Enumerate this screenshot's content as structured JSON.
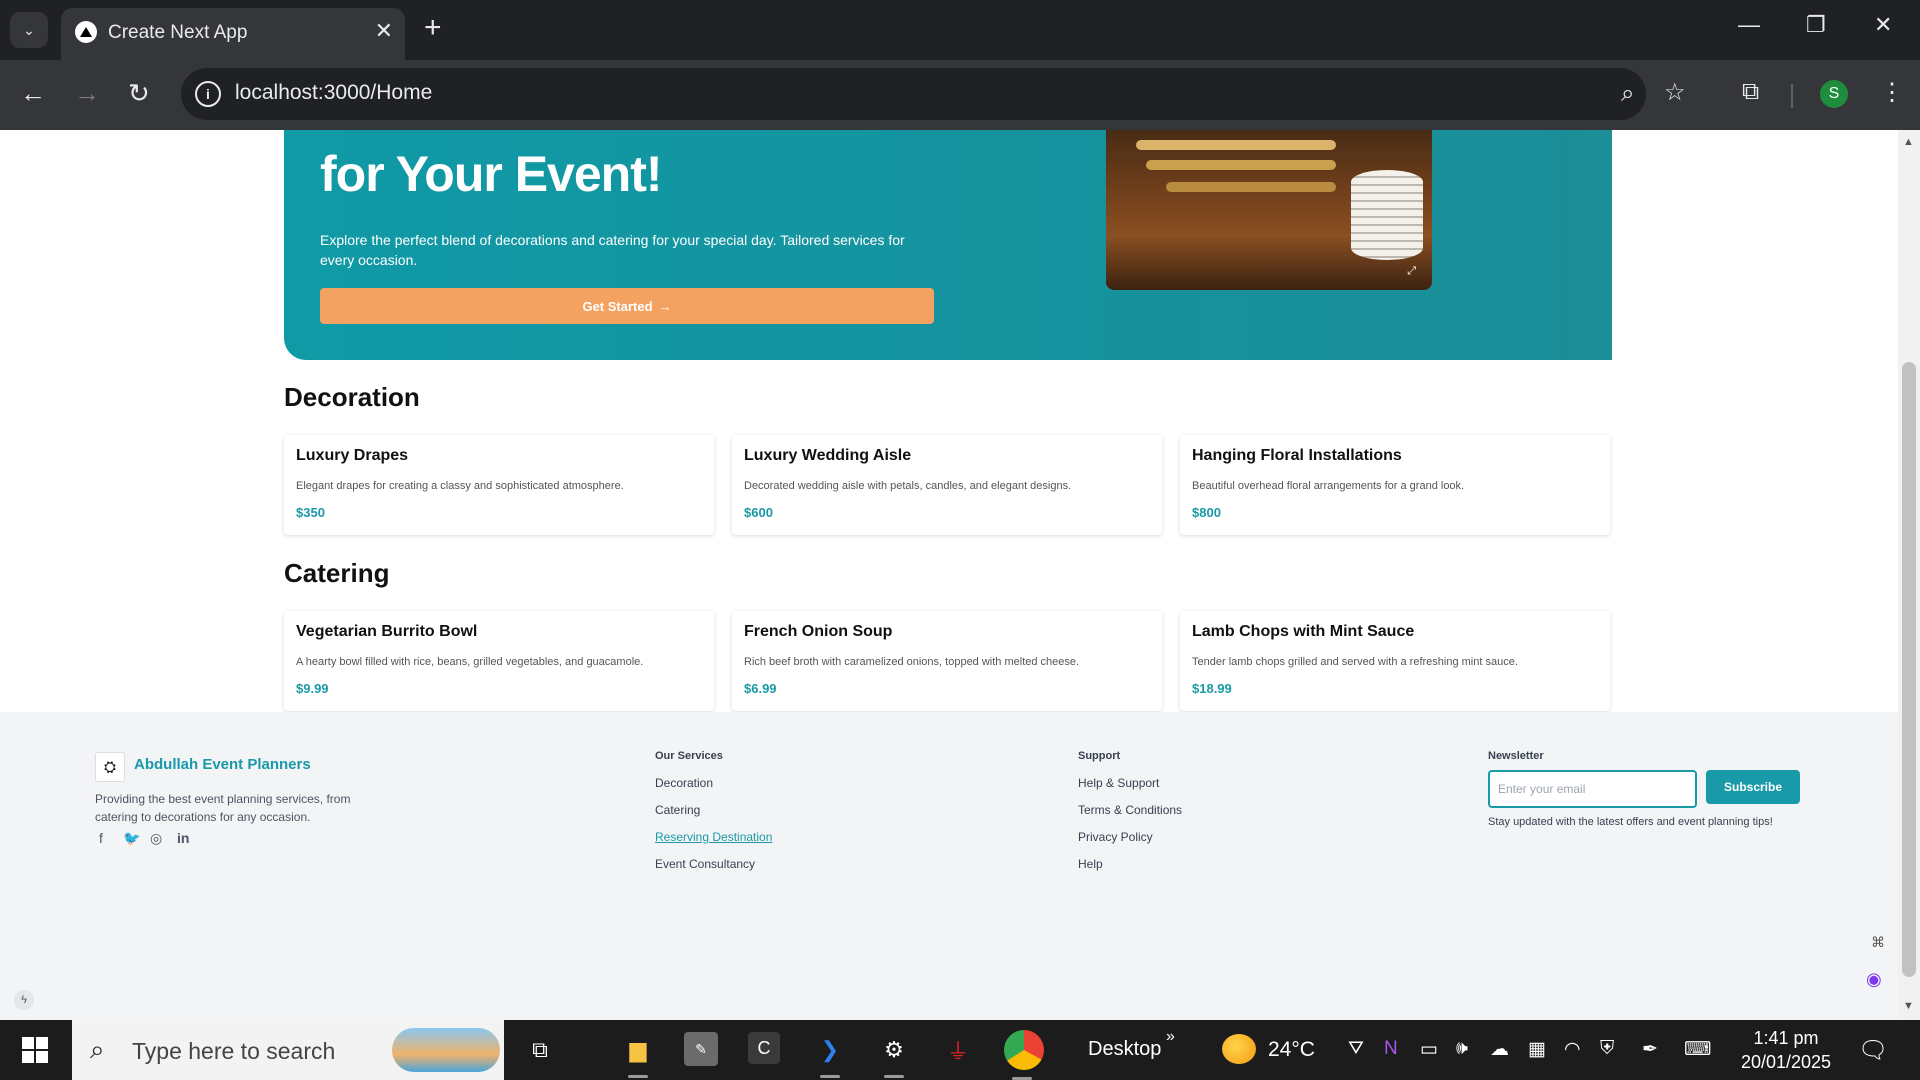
{
  "browser": {
    "tab_title": "Create Next App",
    "url": "localhost:3000/Home",
    "profile_initial": "S",
    "icons": [
      "tab-dropdown-icon",
      "close-icon",
      "plus-icon",
      "minimize-icon",
      "restore-icon",
      "back-icon",
      "forward-icon",
      "reload-icon",
      "info-icon",
      "zoom-icon",
      "star-icon",
      "extensions-icon",
      "kebab-menu-icon"
    ]
  },
  "hero": {
    "title": "for Your Event!",
    "description": "Explore the perfect blend of decorations and catering for your special day. Tailored services for every occasion.",
    "cta_label": "Get Started",
    "cta_icon": "→"
  },
  "decoration": {
    "heading": "Decoration",
    "items": [
      {
        "name": "Luxury Drapes",
        "desc": "Elegant drapes for creating a classy and sophisticated atmosphere.",
        "price": "$350"
      },
      {
        "name": "Luxury Wedding Aisle",
        "desc": "Decorated wedding aisle with petals, candles, and elegant designs.",
        "price": "$600"
      },
      {
        "name": "Hanging Floral Installations",
        "desc": "Beautiful overhead floral arrangements for a grand look.",
        "price": "$800"
      }
    ]
  },
  "catering": {
    "heading": "Catering",
    "items": [
      {
        "name": "Vegetarian Burrito Bowl",
        "desc": "A hearty bowl filled with rice, beans, grilled vegetables, and guacamole.",
        "price": "$9.99"
      },
      {
        "name": "French Onion Soup",
        "desc": "Rich beef broth with caramelized onions, topped with melted cheese.",
        "price": "$6.99"
      },
      {
        "name": "Lamb Chops with Mint Sauce",
        "desc": "Tender lamb chops grilled and served with a refreshing mint sauce.",
        "price": "$18.99"
      }
    ]
  },
  "footer": {
    "brand_name": "Abdullah Event Planners",
    "brand_desc": "Providing the best event planning services, from catering to decorations for any occasion.",
    "social_icons": [
      "facebook-icon",
      "twitter-icon",
      "instagram-icon",
      "linkedin-icon"
    ],
    "services_heading": "Our Services",
    "services": [
      "Decoration",
      "Catering",
      "Reserving Destination",
      "Event Consultancy"
    ],
    "support_heading": "Support",
    "support": [
      "Help & Support",
      "Terms & Conditions",
      "Privacy Policy",
      "Help"
    ],
    "newsletter_heading": "Newsletter",
    "email_placeholder": "Enter your email",
    "subscribe_label": "Subscribe",
    "newsletter_note": "Stay updated with the latest offers and event planning tips!"
  },
  "taskbar": {
    "search_placeholder": "Type here to search",
    "desktop_label": "Desktop",
    "temperature": "24°C",
    "time": "1:41 pm",
    "date": "20/01/2025"
  },
  "colors": {
    "accent": "#1a9aa8",
    "hero_bg": "#0f9aa6",
    "cta": "#f4a261"
  }
}
